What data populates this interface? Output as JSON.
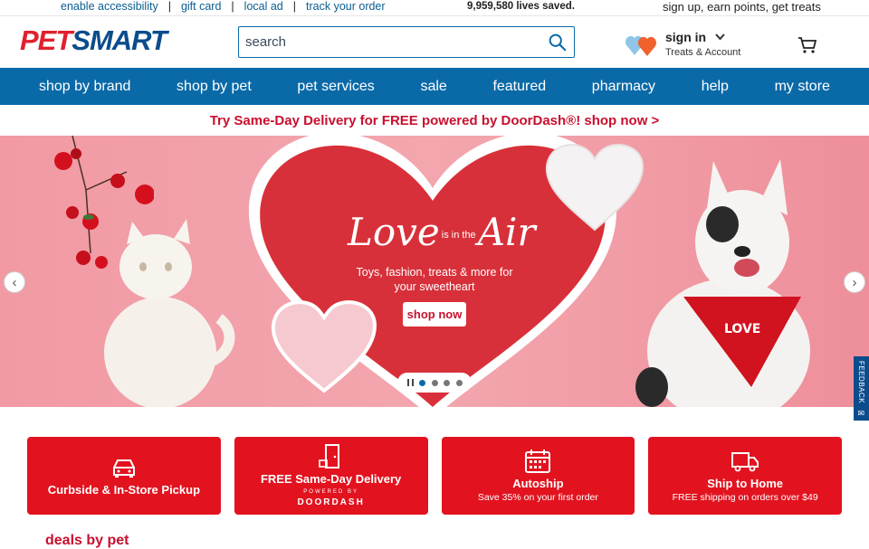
{
  "util": {
    "links": [
      "enable accessibility",
      "gift card",
      "local ad",
      "track your order"
    ],
    "separator": "|",
    "lives_saved": "9,959,580 lives saved.",
    "signup": "sign up, earn points, get treats"
  },
  "header": {
    "logo_pet": "PET",
    "logo_smart": "SMART",
    "search_placeholder": "search",
    "signin": "sign in",
    "treats_account": "Treats & Account"
  },
  "nav": {
    "items": [
      "shop by brand",
      "shop by pet",
      "pet services",
      "sale",
      "featured",
      "pharmacy",
      "help",
      "my store"
    ]
  },
  "promo": {
    "text": "Try Same-Day Delivery for FREE powered by DoorDash®! shop now >"
  },
  "hero": {
    "love": "Love",
    "is_in_the": "is in the",
    "air": "Air",
    "subtitle": "Toys, fashion, treats & more for your sweetheart",
    "button": "shop now",
    "slides": 4,
    "active_slide": 1
  },
  "feedback": "FEEDBACK",
  "cards": [
    {
      "title": "Curbside & In-Store Pickup",
      "subtitle": "",
      "icon": "car-icon"
    },
    {
      "title": "FREE Same-Day Delivery",
      "powered": "POWERED BY",
      "brand": "DOORDASH",
      "icon": "door-icon"
    },
    {
      "title": "Autoship",
      "subtitle": "Save 35% on your first order",
      "icon": "calendar-icon"
    },
    {
      "title": "Ship to Home",
      "subtitle": "FREE shipping on orders over $49",
      "icon": "truck-icon"
    }
  ],
  "deals_heading": "deals by pet",
  "colors": {
    "brand_red": "#e2131f",
    "brand_blue": "#0a6aa8",
    "promo_red": "#c8102e"
  }
}
